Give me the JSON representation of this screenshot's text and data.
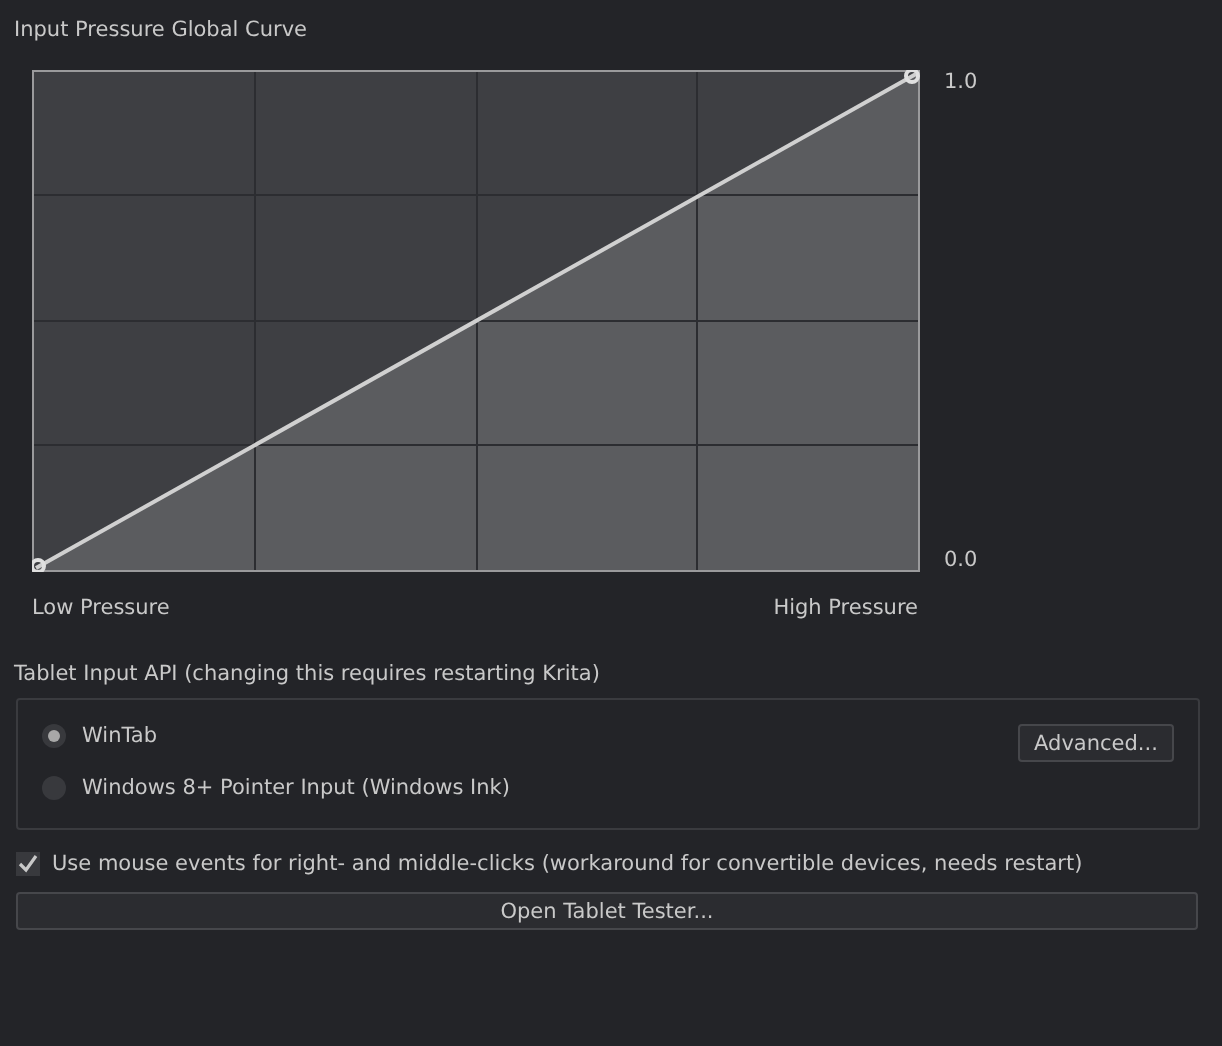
{
  "curve": {
    "title": "Input Pressure Global Curve",
    "top_label": "1.0",
    "bottom_label": "0.0",
    "low_label": "Low Pressure",
    "high_label": "High Pressure"
  },
  "tablet_api": {
    "title": "Tablet Input API (changing this requires restarting Krita)",
    "options": [
      {
        "label": "WinTab",
        "selected": true
      },
      {
        "label": "Windows 8+ Pointer Input (Windows Ink)",
        "selected": false
      }
    ],
    "advanced_button": "Advanced..."
  },
  "mouse_events": {
    "label": "Use mouse events for right- and middle-clicks (workaround for convertible devices, needs restart)",
    "checked": true
  },
  "tester_button": "Open Tablet Tester..."
}
